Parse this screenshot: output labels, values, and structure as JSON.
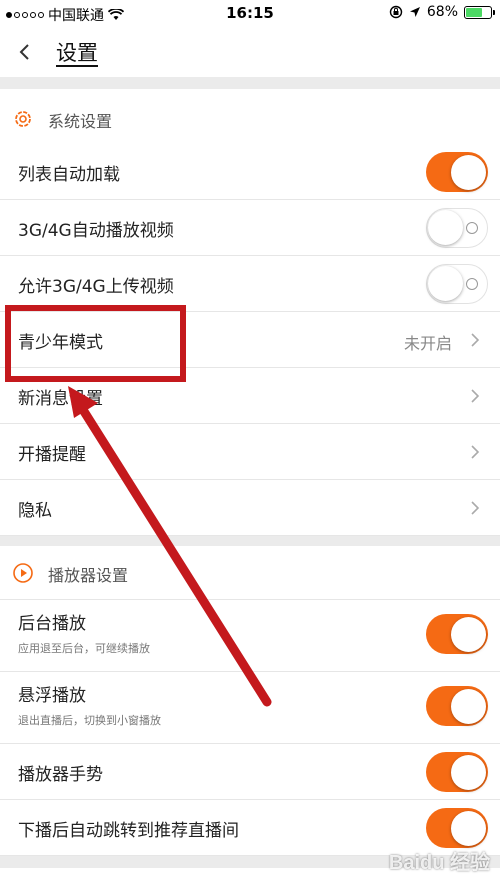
{
  "status_bar": {
    "carrier": "中国联通",
    "time": "16:15",
    "battery": "68%",
    "battery_level": 0.68
  },
  "nav": {
    "title": "设置"
  },
  "system_section": {
    "title": "系统设置",
    "icon": "gear-icon",
    "rows": [
      {
        "label": "列表自动加载",
        "toggle": true
      },
      {
        "label": "3G/4G自动播放视频",
        "toggle": false
      },
      {
        "label": "允许3G/4G上传视频",
        "toggle": false
      },
      {
        "label": "青少年模式",
        "value": "未开启"
      },
      {
        "label": "新消息设置"
      },
      {
        "label": "开播提醒"
      },
      {
        "label": "隐私"
      }
    ]
  },
  "player_section": {
    "title": "播放器设置",
    "icon": "play-circle-icon",
    "rows": [
      {
        "label": "后台播放",
        "sublabel": "应用退至后台，可继续播放",
        "toggle": true
      },
      {
        "label": "悬浮播放",
        "sublabel": "退出直播后，切换到小窗播放",
        "toggle": true
      },
      {
        "label": "播放器手势",
        "toggle": true
      },
      {
        "label": "下播后自动跳转到推荐直播间",
        "toggle": true
      }
    ]
  },
  "colors": {
    "accent": "#f56a14",
    "annotation": "#c4191d"
  },
  "watermark": "Baidu 经验"
}
